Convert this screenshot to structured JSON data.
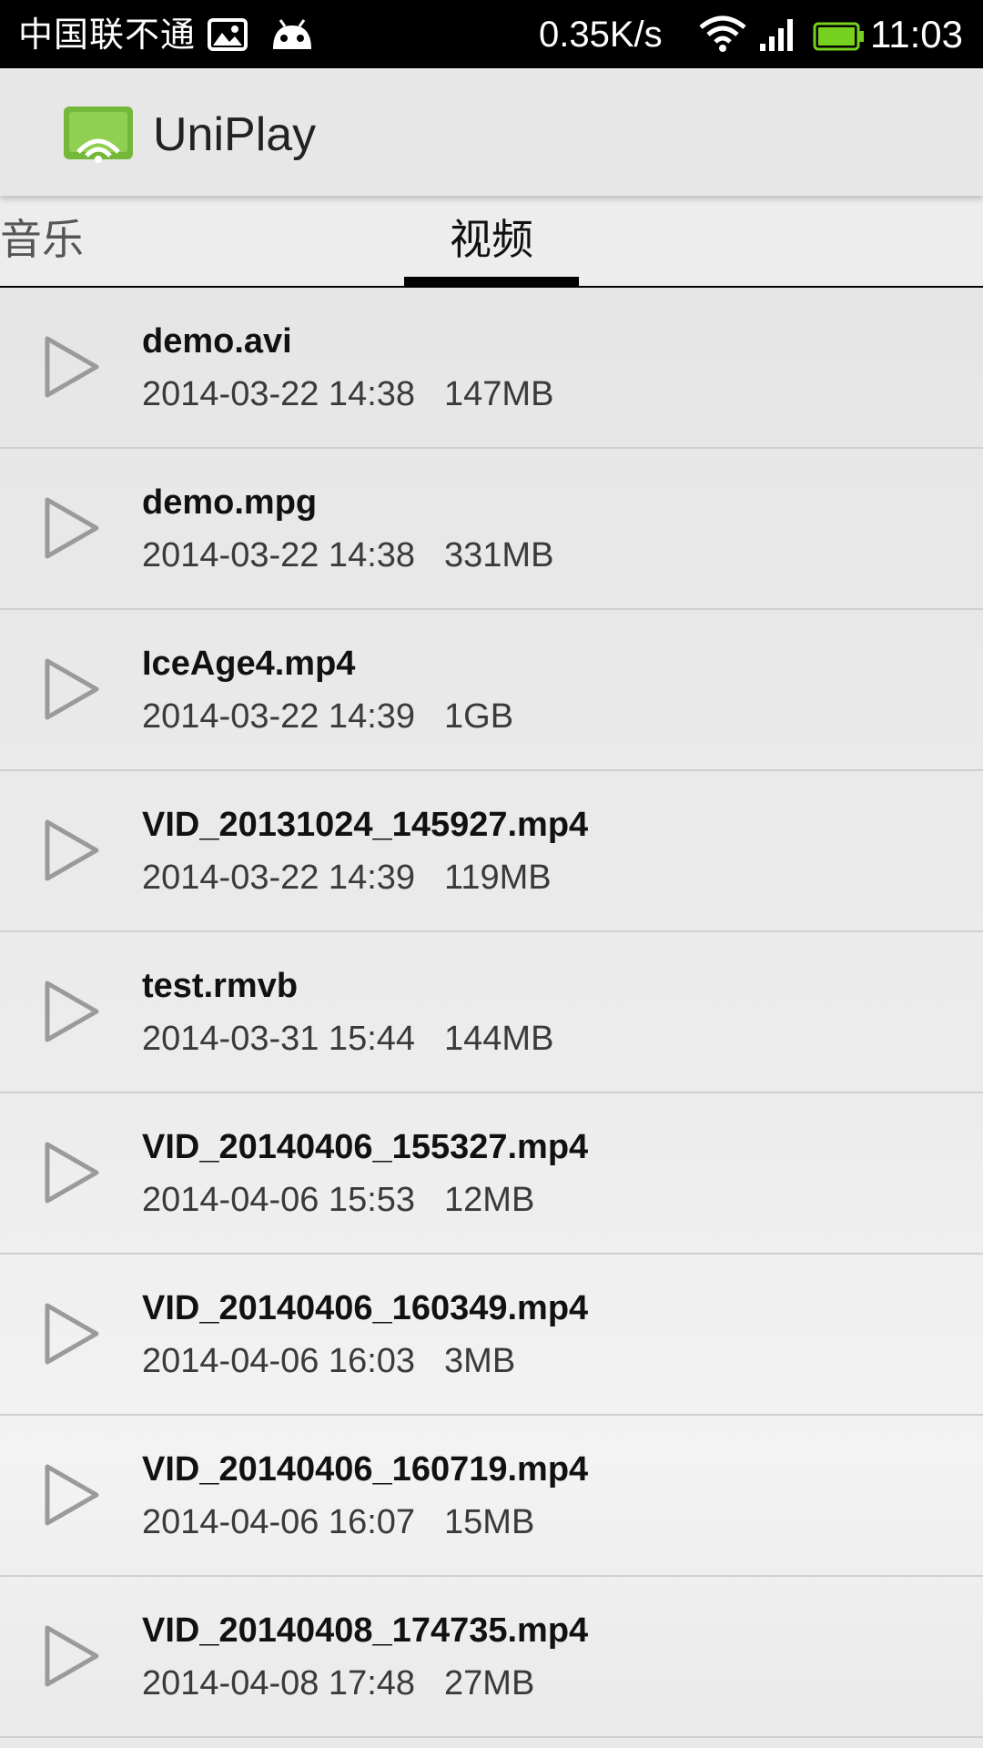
{
  "status_bar": {
    "carrier": "中国联不通",
    "net_speed": "0.35K/s",
    "time": "11:03",
    "icons": [
      "image-icon",
      "android-icon",
      "wifi-icon",
      "signal-icon",
      "battery-icon"
    ],
    "battery_color": "#76d21f"
  },
  "app_bar": {
    "title": "UniPlay",
    "icon": "cast-screen-icon",
    "icon_color": "#74b83a"
  },
  "tabs": [
    {
      "label": "音乐",
      "selected": false
    },
    {
      "label": "视频",
      "selected": true
    }
  ],
  "files": [
    {
      "name": "demo.avi",
      "date": "2014-03-22 14:38",
      "size": "147MB"
    },
    {
      "name": "demo.mpg",
      "date": "2014-03-22 14:38",
      "size": "331MB"
    },
    {
      "name": "IceAge4.mp4",
      "date": "2014-03-22 14:39",
      "size": "1GB"
    },
    {
      "name": "VID_20131024_145927.mp4",
      "date": "2014-03-22 14:39",
      "size": "119MB"
    },
    {
      "name": "test.rmvb",
      "date": "2014-03-31 15:44",
      "size": "144MB"
    },
    {
      "name": "VID_20140406_155327.mp4",
      "date": "2014-04-06 15:53",
      "size": "12MB"
    },
    {
      "name": "VID_20140406_160349.mp4",
      "date": "2014-04-06 16:03",
      "size": "3MB"
    },
    {
      "name": "VID_20140406_160719.mp4",
      "date": "2014-04-06 16:07",
      "size": "15MB"
    },
    {
      "name": "VID_20140408_174735.mp4",
      "date": "2014-04-08 17:48",
      "size": "27MB"
    }
  ]
}
